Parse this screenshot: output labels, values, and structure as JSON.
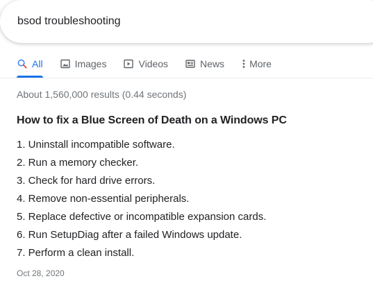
{
  "search": {
    "query": "bsod troubleshooting"
  },
  "tabs": [
    {
      "label": "All",
      "icon": "search-icon",
      "active": true
    },
    {
      "label": "Images",
      "icon": "image-icon",
      "active": false
    },
    {
      "label": "Videos",
      "icon": "video-icon",
      "active": false
    },
    {
      "label": "News",
      "icon": "news-icon",
      "active": false
    },
    {
      "label": "More",
      "icon": "more-vert-icon",
      "active": false
    }
  ],
  "result_stats": "About 1,560,000 results (0.44 seconds)",
  "featured_snippet": {
    "title": "How to fix a Blue Screen of Death on a Windows PC",
    "steps": [
      "1. Uninstall incompatible software.",
      "2. Run a memory checker.",
      "3. Check for hard drive errors.",
      "4. Remove non-essential peripherals.",
      "5. Replace defective or incompatible expansion cards.",
      "6. Run SetupDiag after a failed Windows update.",
      "7. Perform a clean install."
    ],
    "date": "Oct 28, 2020"
  },
  "colors": {
    "accent": "#1a73e8",
    "muted": "#70757a",
    "tab_text": "#5f6368",
    "text": "#202124"
  }
}
